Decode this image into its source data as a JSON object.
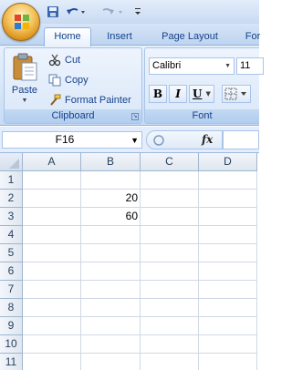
{
  "tabs": [
    "Home",
    "Insert",
    "Page Layout",
    "For"
  ],
  "clipboard": {
    "paste_label": "Paste",
    "cut_label": "Cut",
    "copy_label": "Copy",
    "format_painter_label": "Format Painter",
    "group_label": "Clipboard"
  },
  "font": {
    "name": "Calibri",
    "size": "11",
    "group_label": "Font",
    "bold": "B",
    "italic": "I",
    "underline": "U"
  },
  "formula_bar": {
    "name_box": "F16",
    "fx_label": "fx",
    "formula": ""
  },
  "sheet": {
    "columns": [
      "A",
      "B",
      "C",
      "D"
    ],
    "rows": [
      "1",
      "2",
      "3",
      "4",
      "5",
      "6",
      "7",
      "8",
      "9",
      "10",
      "11"
    ],
    "cells": {
      "B2": "20",
      "B3": "60"
    }
  },
  "colors": {
    "accent": "#15428b",
    "ribbon_bg": "#dbe7f8",
    "header_border": "#9eb6ce",
    "gridline": "#d0d7e5"
  }
}
